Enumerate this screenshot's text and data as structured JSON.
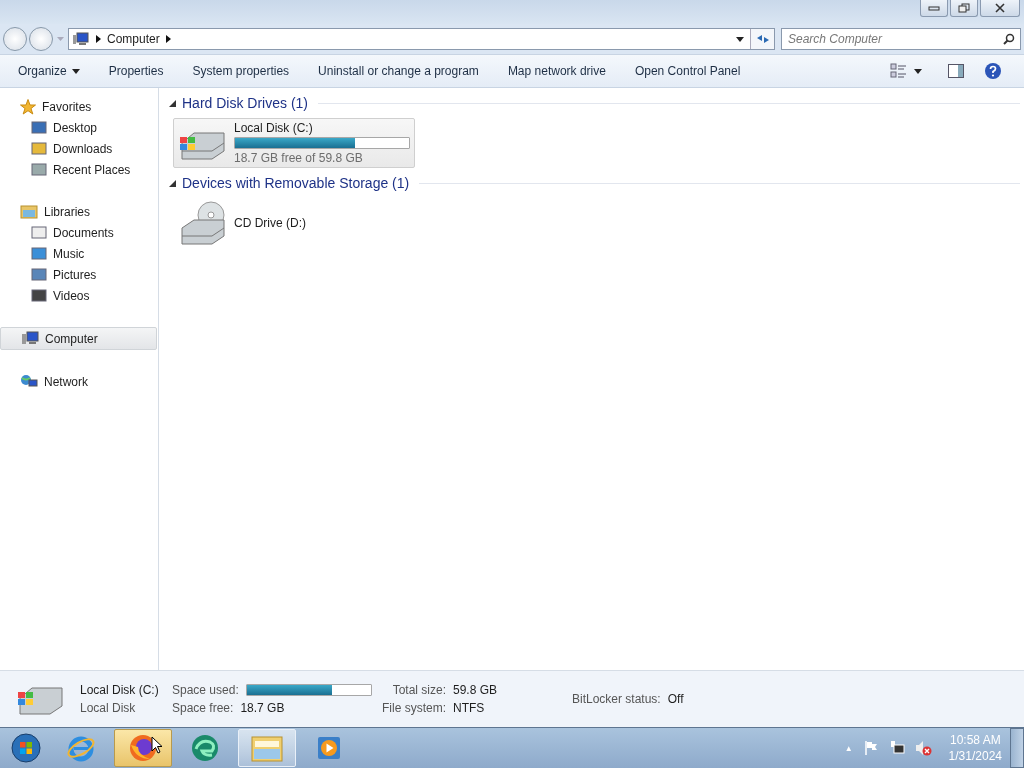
{
  "address_bar": {
    "path": [
      "Computer"
    ]
  },
  "search": {
    "placeholder": "Search Computer"
  },
  "toolbar": {
    "items": [
      {
        "label": "Organize",
        "dropdown": true
      },
      {
        "label": "Properties",
        "dropdown": false
      },
      {
        "label": "System properties",
        "dropdown": false
      },
      {
        "label": "Uninstall or change a program",
        "dropdown": false
      },
      {
        "label": "Map network drive",
        "dropdown": false
      },
      {
        "label": "Open Control Panel",
        "dropdown": false
      }
    ]
  },
  "sidebar": {
    "groups": [
      {
        "label": "Favorites",
        "selected": false,
        "children": [
          {
            "label": "Desktop",
            "selected": false
          },
          {
            "label": "Downloads",
            "selected": false
          },
          {
            "label": "Recent Places",
            "selected": false
          }
        ]
      },
      {
        "label": "Libraries",
        "selected": false,
        "children": [
          {
            "label": "Documents",
            "selected": false
          },
          {
            "label": "Music",
            "selected": false
          },
          {
            "label": "Pictures",
            "selected": false
          },
          {
            "label": "Videos",
            "selected": false
          }
        ]
      },
      {
        "label": "Computer",
        "selected": true
      },
      {
        "label": "Network",
        "selected": false
      }
    ]
  },
  "sections": [
    {
      "title": "Hard Disk Drives (1)",
      "expanded": true,
      "drives": [
        {
          "kind": "hard-disk",
          "name": "Local Disk (C:)",
          "level": 0.69,
          "free_text": "18.7 GB free of 59.8 GB",
          "selected": true
        }
      ]
    },
    {
      "title": "Devices with Removable Storage (1)",
      "expanded": true,
      "drives": [
        {
          "kind": "cd",
          "name": "CD Drive (D:)",
          "selected": false
        }
      ]
    }
  ],
  "details": {
    "name": "Local Disk (C:)",
    "type": "Local Disk",
    "space_used_label": "Space used:",
    "level": 0.69,
    "space_free_label": "Space free:",
    "space_free": "18.7 GB",
    "total_size_label": "Total size:",
    "total_size": "59.8 GB",
    "file_system_label": "File system:",
    "file_system": "NTFS",
    "bitlocker_label": "BitLocker status:",
    "bitlocker": "Off"
  },
  "taskbar": {
    "apps": [
      {
        "kind": "ie",
        "highlighted": false,
        "open": false
      },
      {
        "kind": "firefox",
        "highlighted": true,
        "open": false
      },
      {
        "kind": "edge",
        "highlighted": false,
        "open": false
      },
      {
        "kind": "explorer",
        "highlighted": false,
        "open": true
      },
      {
        "kind": "media",
        "highlighted": false,
        "open": false
      }
    ],
    "tray_up": "▲",
    "time": "10:58 AM",
    "date": "1/31/2024"
  }
}
